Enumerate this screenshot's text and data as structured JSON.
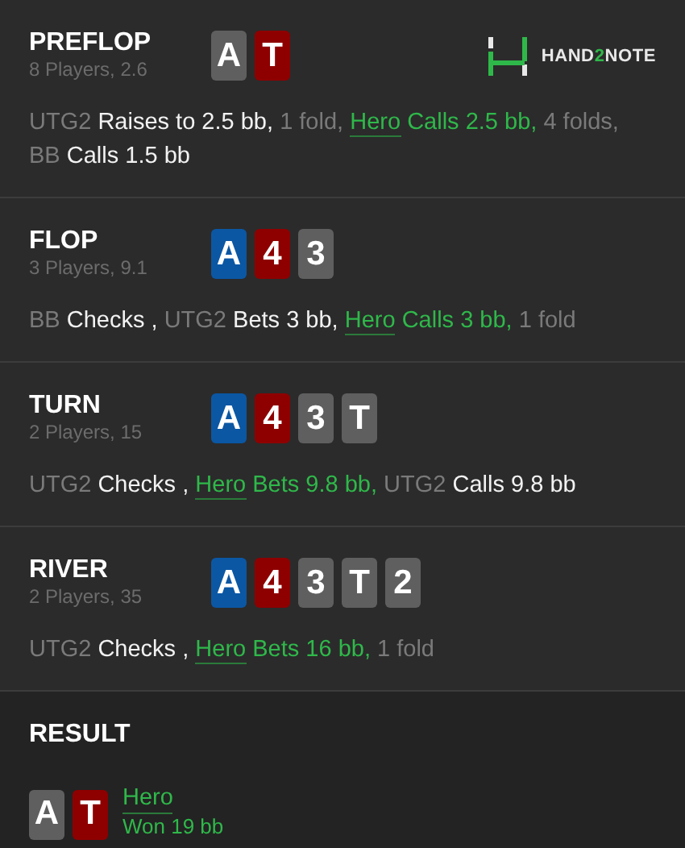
{
  "logo": {
    "before": "HAND",
    "highlight": "2",
    "after": "NOTE"
  },
  "streets": [
    {
      "title": "PREFLOP",
      "subtitle": "8 Players, 2.6",
      "cards": [
        {
          "rank": "A",
          "color": "#5f5f5f"
        },
        {
          "rank": "T",
          "color": "#8e0000"
        }
      ],
      "actions": [
        {
          "kind": "player",
          "text": "UTG2"
        },
        {
          "kind": "action",
          "text": "Raises to 2.5 bb,"
        },
        {
          "kind": "note",
          "text": "1 fold,"
        },
        {
          "kind": "hero",
          "text": "Hero"
        },
        {
          "kind": "hero_action",
          "text": "Calls 2.5 bb,"
        },
        {
          "kind": "note",
          "text": "4 folds,"
        },
        {
          "kind": "player",
          "text": "BB"
        },
        {
          "kind": "action",
          "text": "Calls 1.5 bb"
        }
      ]
    },
    {
      "title": "FLOP",
      "subtitle": "3 Players, 9.1",
      "cards": [
        {
          "rank": "A",
          "color": "#0b57a4"
        },
        {
          "rank": "4",
          "color": "#8e0000"
        },
        {
          "rank": "3",
          "color": "#5f5f5f"
        }
      ],
      "actions": [
        {
          "kind": "player",
          "text": "BB"
        },
        {
          "kind": "action",
          "text": "Checks ,"
        },
        {
          "kind": "player",
          "text": "UTG2"
        },
        {
          "kind": "action",
          "text": "Bets 3 bb,"
        },
        {
          "kind": "hero",
          "text": "Hero"
        },
        {
          "kind": "hero_action",
          "text": "Calls 3 bb,"
        },
        {
          "kind": "note",
          "text": "1 fold"
        }
      ]
    },
    {
      "title": "TURN",
      "subtitle": "2 Players, 15",
      "cards": [
        {
          "rank": "A",
          "color": "#0b57a4"
        },
        {
          "rank": "4",
          "color": "#8e0000"
        },
        {
          "rank": "3",
          "color": "#5f5f5f"
        },
        {
          "rank": "T",
          "color": "#5f5f5f"
        }
      ],
      "actions": [
        {
          "kind": "player",
          "text": "UTG2"
        },
        {
          "kind": "action",
          "text": "Checks ,"
        },
        {
          "kind": "hero",
          "text": "Hero"
        },
        {
          "kind": "hero_action",
          "text": "Bets 9.8 bb,"
        },
        {
          "kind": "player",
          "text": "UTG2"
        },
        {
          "kind": "action",
          "text": "Calls 9.8 bb"
        }
      ]
    },
    {
      "title": "RIVER",
      "subtitle": "2 Players, 35",
      "cards": [
        {
          "rank": "A",
          "color": "#0b57a4"
        },
        {
          "rank": "4",
          "color": "#8e0000"
        },
        {
          "rank": "3",
          "color": "#5f5f5f"
        },
        {
          "rank": "T",
          "color": "#5f5f5f"
        },
        {
          "rank": "2",
          "color": "#5f5f5f"
        }
      ],
      "actions": [
        {
          "kind": "player",
          "text": "UTG2"
        },
        {
          "kind": "action",
          "text": "Checks ,"
        },
        {
          "kind": "hero",
          "text": "Hero"
        },
        {
          "kind": "hero_action",
          "text": "Bets 16 bb,"
        },
        {
          "kind": "note",
          "text": "1 fold"
        }
      ]
    }
  ],
  "result": {
    "title": "RESULT",
    "cards": [
      {
        "rank": "A",
        "color": "#5f5f5f"
      },
      {
        "rank": "T",
        "color": "#8e0000"
      }
    ],
    "player": "Hero",
    "outcome": "Won 19 bb"
  }
}
